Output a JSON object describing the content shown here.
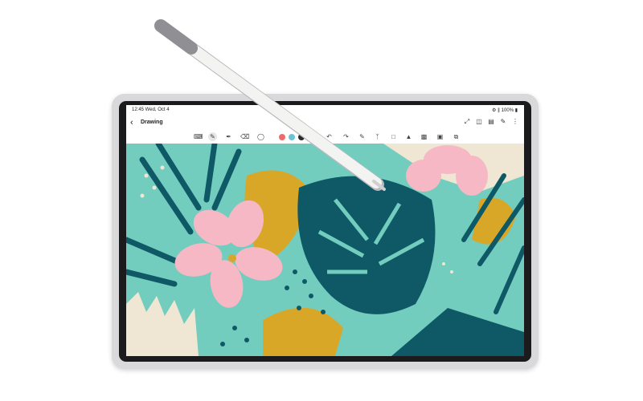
{
  "status": {
    "time": "12:45 Wed, Oct 4",
    "right": "⚙ ∥ 100% ▮"
  },
  "app": {
    "title": "Drawing",
    "back_icon": "chevron-left-icon"
  },
  "top_actions": [
    "expand-icon",
    "book-icon",
    "page-icon",
    "pen-icon",
    "more-icon"
  ],
  "toolbar": {
    "tools": [
      "keyboard-icon",
      "pen-tool-icon",
      "brush-icon",
      "eraser-icon",
      "lasso-icon"
    ],
    "colors": [
      "#ef6b6b",
      "#6cc3d5",
      "#2a2a2a"
    ],
    "actions": [
      "undo-icon",
      "redo-icon",
      "insert-icon",
      "text-icon",
      "shape-icon",
      "layers-icon",
      "fill-icon",
      "stamp-icon",
      "copy-icon"
    ]
  },
  "palette": {
    "teal": "#73cdbf",
    "dark_teal": "#0f5966",
    "pink": "#f6b8c4",
    "mustard": "#d9a728",
    "cream": "#efe6d3"
  }
}
